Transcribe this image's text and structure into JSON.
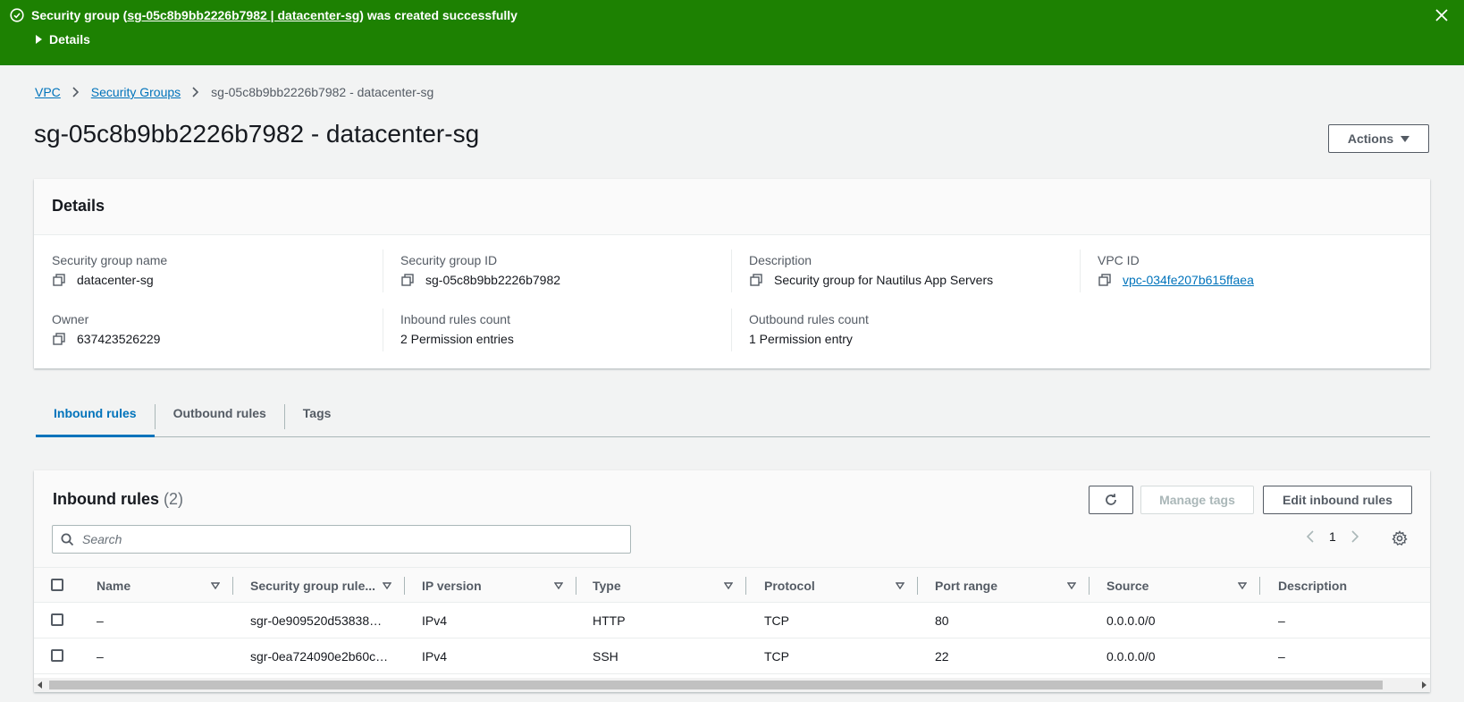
{
  "flash": {
    "prefix": "Security group (",
    "link_text": "sg-05c8b9bb2226b7982 | datacenter-sg",
    "suffix": ") was created successfully",
    "details_label": "Details"
  },
  "breadcrumb": {
    "items": [
      "VPC",
      "Security Groups"
    ],
    "current": "sg-05c8b9bb2226b7982 - datacenter-sg"
  },
  "page_title": "sg-05c8b9bb2226b7982 - datacenter-sg",
  "actions_label": "Actions",
  "details": {
    "title": "Details",
    "fields": [
      {
        "label": "Security group name",
        "value": "datacenter-sg"
      },
      {
        "label": "Security group ID",
        "value": "sg-05c8b9bb2226b7982"
      },
      {
        "label": "Description",
        "value": "Security group for Nautilus App Servers"
      },
      {
        "label": "VPC ID",
        "value": "vpc-034fe207b615ffaea"
      },
      {
        "label": "Owner",
        "value": "637423526229"
      },
      {
        "label": "Inbound rules count",
        "value": "2 Permission entries"
      },
      {
        "label": "Outbound rules count",
        "value": "1 Permission entry"
      }
    ]
  },
  "tabs": [
    "Inbound rules",
    "Outbound rules",
    "Tags"
  ],
  "inbound": {
    "title": "Inbound rules",
    "count": "(2)",
    "manage_tags_label": "Manage tags",
    "edit_label": "Edit inbound rules",
    "search_placeholder": "Search",
    "page": "1",
    "columns": [
      "Name",
      "Security group rule...",
      "IP version",
      "Type",
      "Protocol",
      "Port range",
      "Source",
      "Description"
    ],
    "rows": [
      [
        "–",
        "sgr-0e909520d53838…",
        "IPv4",
        "HTTP",
        "TCP",
        "80",
        "0.0.0.0/0",
        "–"
      ],
      [
        "–",
        "sgr-0ea724090e2b60c…",
        "IPv4",
        "SSH",
        "TCP",
        "22",
        "0.0.0.0/0",
        "–"
      ]
    ]
  },
  "colors": {
    "success": "#1d8102",
    "link": "#0073bb",
    "text": "#16191f",
    "muted": "#545b64"
  }
}
